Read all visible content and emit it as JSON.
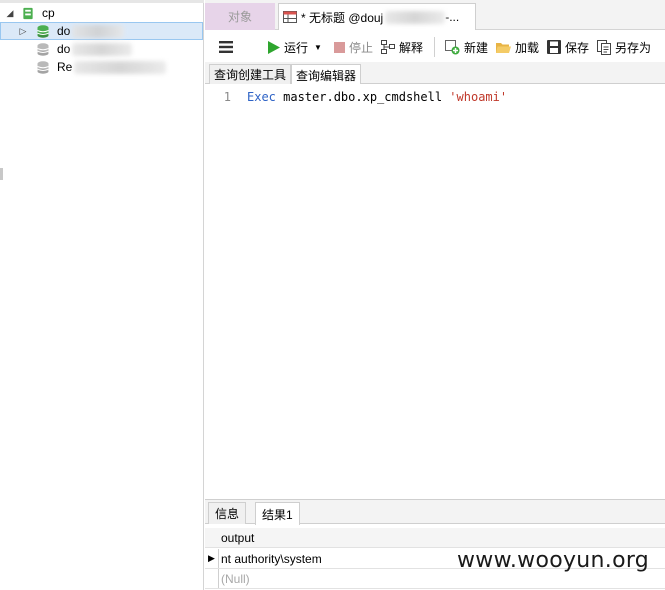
{
  "navigator": {
    "items": [
      {
        "label": "cp",
        "expanded": true
      },
      {
        "label": "do",
        "selected": true,
        "icon": "database-open-icon"
      },
      {
        "label": "do",
        "icon": "database-icon"
      },
      {
        "label": "Re",
        "icon": "database-icon"
      }
    ]
  },
  "tabs": {
    "objects": "对象",
    "query_title": "* 无标题 @douj",
    "query_suffix": "-..."
  },
  "toolbar": {
    "run": "运行",
    "stop": "停止",
    "explain": "解释",
    "new": "新建",
    "load": "加载",
    "save": "保存",
    "save_as": "另存为"
  },
  "subtabs": {
    "builder": "查询创建工具",
    "editor": "查询编辑器"
  },
  "editor": {
    "line_number": "1",
    "keyword": "Exec",
    "code": " master.dbo.xp_cmdshell ",
    "string": "'whoami'"
  },
  "results": {
    "tabs": [
      "信息",
      "结果1"
    ],
    "column": "output",
    "rows": [
      "nt authority\\system",
      "(Null)"
    ]
  },
  "watermark": "www.wooyun.org",
  "colors": {
    "accent_tab": "#e7d4e9",
    "keyword": "#2e63c6",
    "string": "#c0392b",
    "selection": "#dbe9f8"
  }
}
